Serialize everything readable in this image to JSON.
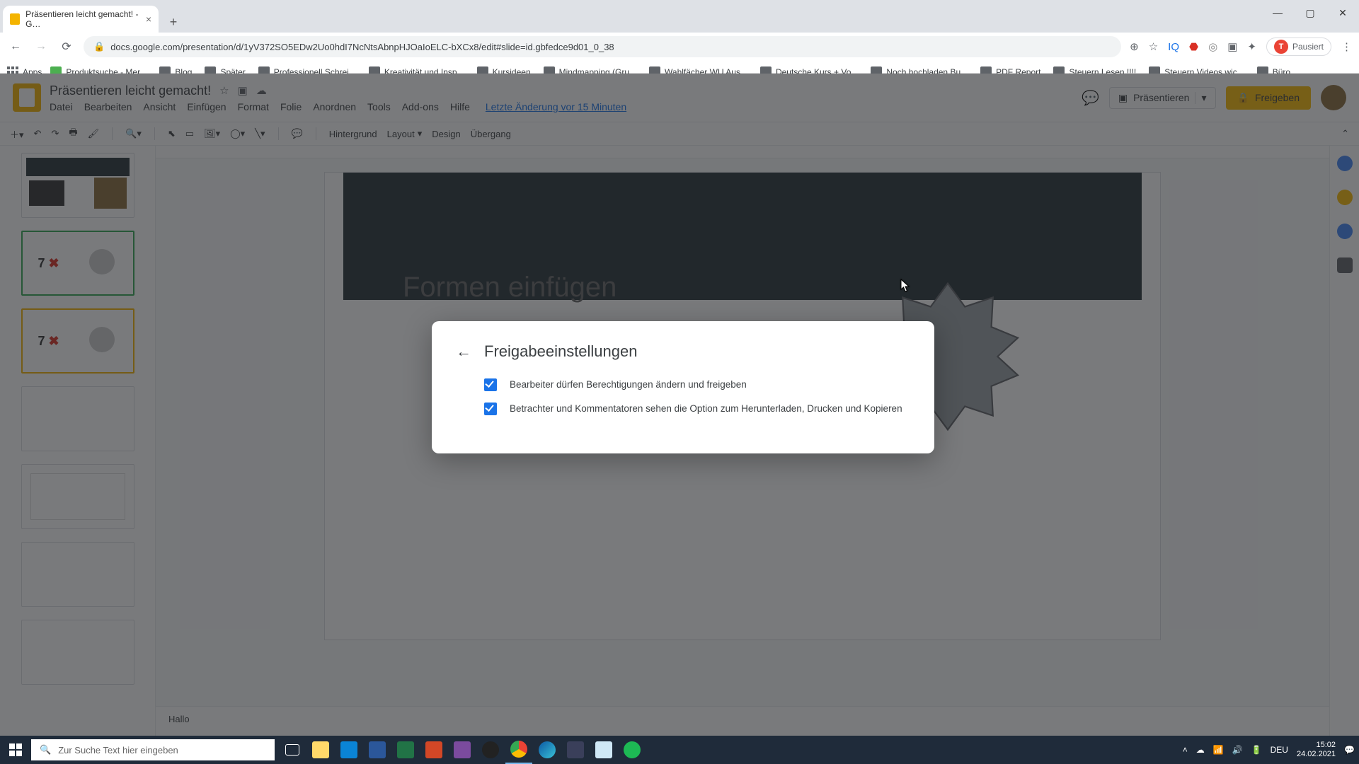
{
  "browser": {
    "tab_title": "Präsentieren leicht gemacht! - G…",
    "url": "docs.google.com/presentation/d/1yV372SO5EDw2Uo0hdI7NcNtsAbnpHJOaIoELC-bXCx8/edit#slide=id.gbfedce9d01_0_38",
    "paused_label": "Pausiert",
    "paused_initial": "T",
    "apps_label": "Apps",
    "bookmarks": [
      "Produktsuche - Mer...",
      "Blog",
      "Später",
      "Professionell Schrei...",
      "Kreativität und Insp...",
      "Kursideen",
      "Mindmapping  (Gru...",
      "Wahlfächer WU Aus...",
      "Deutsche Kurs + Vo...",
      "Noch hochladen Bu...",
      "PDF Report",
      "Steuern Lesen !!!!",
      "Steuern Videos wic...",
      "Büro"
    ]
  },
  "slides": {
    "doc_title": "Präsentieren leicht gemacht!",
    "menus": [
      "Datei",
      "Bearbeiten",
      "Ansicht",
      "Einfügen",
      "Format",
      "Folie",
      "Anordnen",
      "Tools",
      "Add-ons",
      "Hilfe"
    ],
    "last_edit": "Letzte Änderung vor 15 Minuten",
    "present_label": "Präsentieren",
    "share_label": "Freigeben",
    "toolbar": {
      "background": "Hintergrund",
      "layout": "Layout",
      "design": "Design",
      "transition": "Übergang"
    },
    "slide_title": "Formen einfügen",
    "notes": "Hallo"
  },
  "modal": {
    "title": "Freigabeeinstellungen",
    "opt1": "Bearbeiter dürfen Berechtigungen ändern und freigeben",
    "opt2": "Betrachter und Kommentatoren sehen die Option zum Herunterladen, Drucken und Kopieren"
  },
  "taskbar": {
    "search_placeholder": "Zur Suche Text hier eingeben",
    "lang": "DEU",
    "time": "15:02",
    "date": "24.02.2021"
  }
}
